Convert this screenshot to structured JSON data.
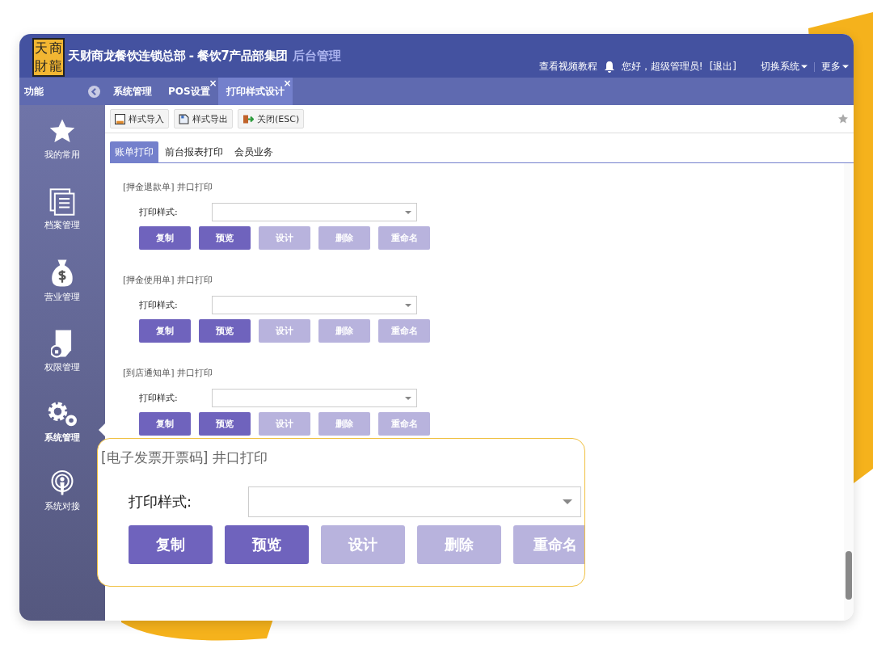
{
  "header": {
    "logo": [
      "天",
      "商",
      "財",
      "龍"
    ],
    "title": "天财商龙餐饮连锁总部 - 餐饮7产品部集团",
    "subtitle": "后台管理",
    "video_link": "查看视频教程",
    "greeting": "您好，超级管理员!",
    "logout": "[退出]",
    "menus": [
      "切换系统",
      "更多"
    ]
  },
  "sidebar": {
    "title": "功能",
    "items": [
      {
        "kind": "star",
        "label": "我的常用",
        "selected": false
      },
      {
        "kind": "archive",
        "label": "档案管理",
        "selected": false
      },
      {
        "kind": "money",
        "label": "营业管理",
        "selected": false
      },
      {
        "kind": "permission",
        "label": "权限管理",
        "selected": false
      },
      {
        "kind": "settings",
        "label": "系统管理",
        "selected": true
      },
      {
        "kind": "connect",
        "label": "系统对接",
        "selected": false
      }
    ]
  },
  "tabs": [
    {
      "label": "系统管理",
      "selected": false,
      "closable": false
    },
    {
      "label": "POS设置",
      "selected": false,
      "closable": true
    },
    {
      "label": "打印样式设计",
      "selected": true,
      "closable": true
    }
  ],
  "tab_close": "×",
  "toolbar": [
    {
      "kind": "import",
      "label": "样式导入"
    },
    {
      "kind": "export",
      "label": "样式导出"
    },
    {
      "kind": "close",
      "label": "关闭(ESC)"
    }
  ],
  "subtabs": [
    {
      "label": "账单打印",
      "selected": true
    },
    {
      "label": "前台报表打印",
      "selected": false
    },
    {
      "label": "会员业务",
      "selected": false
    }
  ],
  "sections": [
    {
      "title": "[押金退款单]",
      "suffix": "井口打印",
      "field_label": "打印样式:",
      "buttons": [
        {
          "label": "复制",
          "disabled": false
        },
        {
          "label": "预览",
          "disabled": false
        },
        {
          "label": "设计",
          "disabled": true
        },
        {
          "label": "删除",
          "disabled": true
        },
        {
          "label": "重命名",
          "disabled": true
        }
      ]
    },
    {
      "title": "[押金使用单]",
      "suffix": "井口打印",
      "field_label": "打印样式:",
      "buttons": [
        {
          "label": "复制",
          "disabled": false
        },
        {
          "label": "预览",
          "disabled": false
        },
        {
          "label": "设计",
          "disabled": true
        },
        {
          "label": "删除",
          "disabled": true
        },
        {
          "label": "重命名",
          "disabled": true
        }
      ]
    },
    {
      "title": "[到店通知单]",
      "suffix": "井口打印",
      "field_label": "打印样式:",
      "buttons": [
        {
          "label": "复制",
          "disabled": false
        },
        {
          "label": "预览",
          "disabled": false
        },
        {
          "label": "设计",
          "disabled": true
        },
        {
          "label": "删除",
          "disabled": true
        },
        {
          "label": "重命名",
          "disabled": true
        }
      ]
    }
  ],
  "callout": {
    "title": "[电子发票开票码]",
    "suffix": "井口打印",
    "field_label": "打印样式:",
    "buttons": [
      {
        "label": "复制",
        "disabled": false
      },
      {
        "label": "预览",
        "disabled": false
      },
      {
        "label": "设计",
        "disabled": true
      },
      {
        "label": "删除",
        "disabled": true
      },
      {
        "label": "重命名",
        "disabled": true
      }
    ]
  }
}
